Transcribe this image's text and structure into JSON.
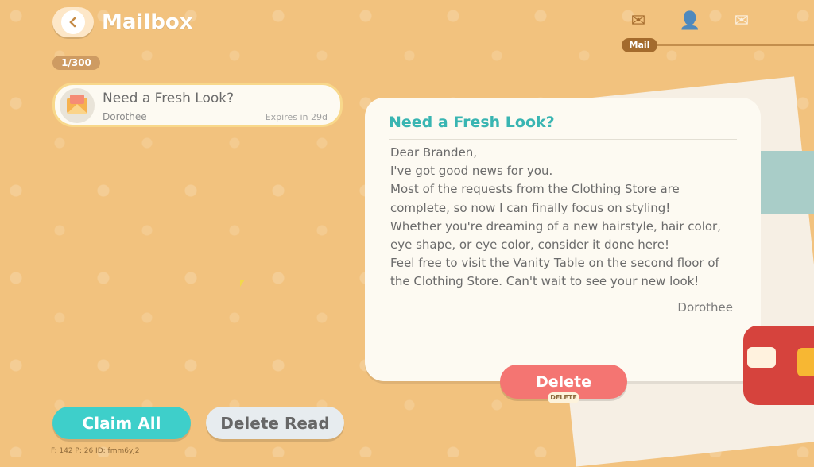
{
  "header": {
    "title": "Mailbox",
    "back_icon": "chevron-left-icon"
  },
  "counter": "1/300",
  "tabs": [
    {
      "icon": "envelope-icon",
      "label": "Mail",
      "active": true
    },
    {
      "icon": "add-friend-icon",
      "label": "",
      "active": false
    },
    {
      "icon": "starred-mail-icon",
      "label": "",
      "active": false
    }
  ],
  "mail_list": [
    {
      "title": "Need a Fresh Look?",
      "sender": "Dorothee",
      "expires": "Expires in 29d"
    }
  ],
  "letter": {
    "title": "Need a Fresh Look?",
    "body": [
      "Dear Branden,",
      "I've got good news for you.",
      "Most of the requests from the Clothing Store are",
      "complete, so now I can finally focus on styling!",
      "Whether you're dreaming of a new hairstyle, hair color,",
      "eye shape, or eye color, consider it done here!",
      "Feel free to visit the Vanity Table on the second floor of",
      "the Clothing Store. Can't wait to see your new look!"
    ],
    "signature": "Dorothee"
  },
  "buttons": {
    "delete": "Delete",
    "delete_badge": "DELETE",
    "claim_all": "Claim All",
    "delete_read": "Delete Read"
  },
  "debug_text": "F: 142   P: 26   ID: fmm6yj2",
  "colors": {
    "background": "#f2c27e",
    "accent_teal": "#3ecfca",
    "delete_red": "#f47572"
  }
}
